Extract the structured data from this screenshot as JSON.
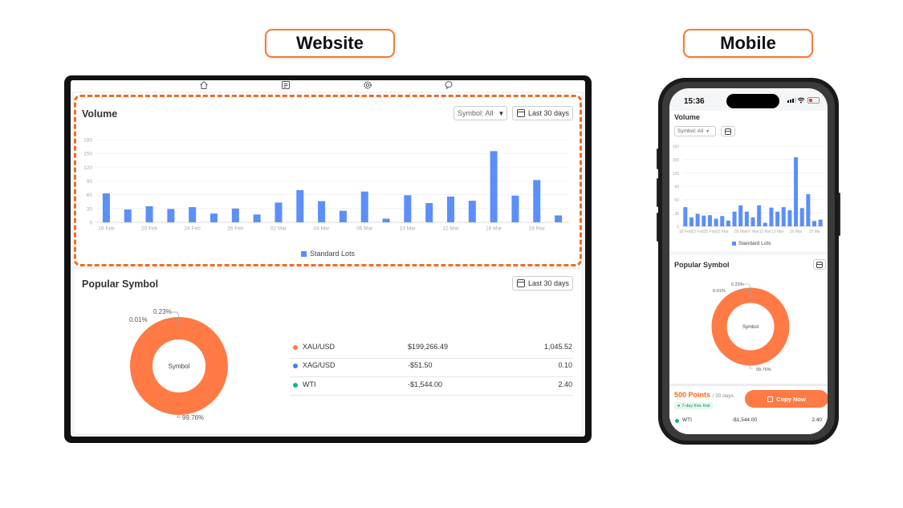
{
  "labels": {
    "website": "Website",
    "mobile": "Mobile"
  },
  "web": {
    "nav_icons": [
      "home-icon",
      "news-icon",
      "settings-icon",
      "chat-icon"
    ],
    "volume": {
      "title": "Volume",
      "symbol_select": "Symbol: All",
      "date_range": "Last 30 days",
      "legend": "Standard Lots"
    },
    "popular": {
      "title": "Popular Symbol",
      "date_range": "Last 30 days",
      "center_label": "Symbol",
      "label_a": "0.23%",
      "label_b": "0.01%",
      "label_c": "99.76%",
      "rows": [
        {
          "symbol": "XAU/USD",
          "amount": "$199,266.49",
          "lots": "1,045.52",
          "color": "#ff7a45"
        },
        {
          "symbol": "XAG/USD",
          "amount": "-$51.50",
          "lots": "0.10",
          "color": "#3b82f6"
        },
        {
          "symbol": "WTI",
          "amount": "-$1,544.00",
          "lots": "2.40",
          "color": "#10b981"
        }
      ]
    }
  },
  "mobile": {
    "time": "15:36",
    "volume": {
      "title": "Volume",
      "symbol_select": "Symbol: All",
      "legend": "Standard Lots"
    },
    "popular": {
      "title": "Popular Symbol",
      "center_label": "Symbol",
      "label_a": "0.23%",
      "label_b": "0.01%",
      "label_c": "99.76%"
    },
    "promo": {
      "points": "500 Points",
      "period": "/ 30 days",
      "trial": "7-day free trial",
      "copy_button": "Copy Now"
    },
    "last_row": {
      "symbol": "WTI",
      "amount": "-$1,544.00",
      "lots": "2.40"
    }
  },
  "chart_data": [
    {
      "type": "bar",
      "title": "Volume",
      "legend": [
        "Standard Lots"
      ],
      "tick_labels": [
        "18 Feb",
        "20 Feb",
        "24 Feb",
        "26 Feb",
        "02 Mar",
        "04 Mar",
        "06 Mar",
        "10 Mar",
        "12 Mar",
        "16 Mar",
        "18 Mar"
      ],
      "ylim": [
        0,
        180
      ],
      "yticks": [
        0,
        30,
        60,
        90,
        120,
        150,
        180
      ],
      "series": [
        {
          "name": "Standard Lots",
          "color": "#5b8ff9",
          "values": [
            63,
            28,
            35,
            29,
            33,
            19,
            30,
            17,
            43,
            70,
            46,
            25,
            67,
            8,
            59,
            42,
            56,
            47,
            155,
            58,
            92,
            15
          ]
        }
      ]
    },
    {
      "type": "bar",
      "title": "Volume",
      "legend": [
        "Standard Lots"
      ],
      "tick_labels": [
        "18 Feb",
        "23 Feb",
        "25 Feb",
        "03 Mar",
        "05 Mar",
        "07 Mar",
        "11 Mar",
        "13 Mar",
        "16 Mar",
        "19 Ma"
      ],
      "ylim": [
        0,
        180
      ],
      "yticks": [
        0,
        30,
        60,
        90,
        120,
        150,
        180
      ],
      "series": [
        {
          "name": "Standard Lots",
          "color": "#5b8ff9",
          "values": [
            43,
            20,
            28,
            24,
            25,
            17,
            23,
            13,
            33,
            47,
            33,
            20,
            47,
            8,
            42,
            33,
            43,
            36,
            155,
            41,
            72,
            12,
            15
          ]
        }
      ]
    },
    {
      "type": "pie",
      "title": "",
      "center_label": "Symbol",
      "slices": [
        {
          "name": "XAU/USD",
          "value": 99.76,
          "color": "#ff7a45"
        },
        {
          "name": "WTI",
          "value": 0.23,
          "color": "#10b981"
        },
        {
          "name": "XAG/USD",
          "value": 0.01,
          "color": "#3b82f6"
        }
      ]
    }
  ]
}
